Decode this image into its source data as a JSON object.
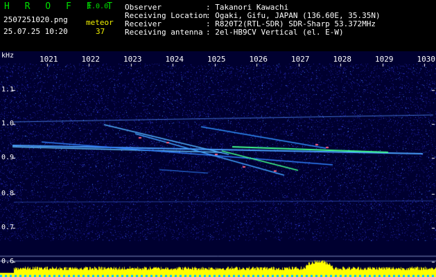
{
  "header": {
    "app_name": "H R O F F T",
    "version": "1.0.0",
    "filename": "2507251020.png",
    "datetime": "25.07.25 10:20",
    "meteor_label": "meteor",
    "meteor_count": "37",
    "observer_label": "Observer",
    "observer_value": ": Takanori Kawachi",
    "location_label": "Receiving Location",
    "location_value": ": Ogaki, Gifu, JAPAN (136.60E, 35.35N)",
    "receiver_label": "Receiver",
    "receiver_value": ": R820T2(RTL-SDR) SDR-Sharp 53.372MHz",
    "antenna_label": "Receiving antenna",
    "antenna_value": ": 2el-HB9CV Vertical (el. E-W)"
  },
  "axes": {
    "y_unit": "kHz",
    "y_ticks": [
      "1.1",
      "1.0",
      "0.9",
      "0.8",
      "0.7",
      "0.6"
    ],
    "x_ticks": [
      "1021",
      "1022",
      "1023",
      "1024",
      "1025",
      "1026",
      "1027",
      "1028",
      "1029",
      "1030"
    ]
  },
  "colors": {
    "background": "#000000",
    "noise": "#1a1a8c",
    "trace": "#40a0ff",
    "meteor_head": "#ff6080",
    "meteor_mid": "#40ff90",
    "spectrum": "#ffff00",
    "baseline": "#00c0ff"
  }
}
